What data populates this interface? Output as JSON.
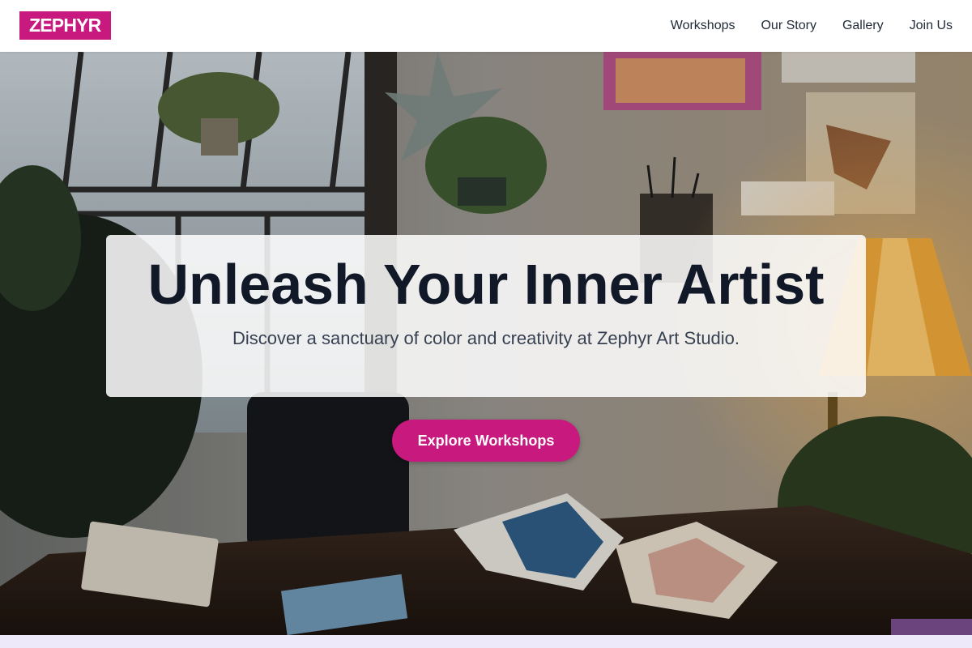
{
  "brand": {
    "logo_text": "ZEPHYR",
    "accent": "#c8197f"
  },
  "nav": {
    "links": [
      "Workshops",
      "Our Story",
      "Gallery",
      "Join Us"
    ]
  },
  "hero": {
    "headline": "Unleash Your Inner Artist",
    "subheadline": "Discover a sanctuary of color and creativity at Zephyr Art Studio.",
    "cta_label": "Explore Workshops",
    "background": "art-studio-photo"
  }
}
